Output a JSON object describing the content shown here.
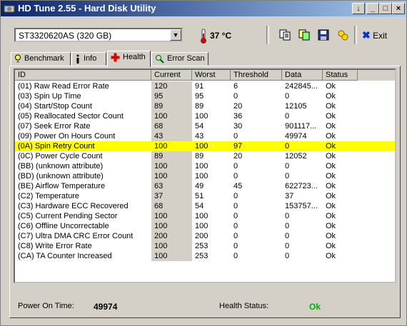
{
  "window": {
    "title": "HD Tune 2.55 - Hard Disk Utility"
  },
  "titlebar_buttons": {
    "down": "↓",
    "minimize": "_",
    "maximize": "□",
    "close": "×"
  },
  "toolbar": {
    "drive": "ST3320620AS (320 GB)",
    "temperature": "37 °C",
    "exit_label": "Exit"
  },
  "tabs": [
    {
      "label": "Benchmark",
      "icon": "lightbulb-icon"
    },
    {
      "label": "Info",
      "icon": "info-icon"
    },
    {
      "label": "Health",
      "icon": "health-cross-icon",
      "active": true
    },
    {
      "label": "Error Scan",
      "icon": "magnifier-icon"
    }
  ],
  "columns": [
    "ID",
    "Current",
    "Worst",
    "Threshold",
    "Data",
    "Status"
  ],
  "rows": [
    {
      "id": "(01) Raw Read Error Rate",
      "current": "120",
      "worst": "91",
      "threshold": "6",
      "data": "242845...",
      "status": "Ok"
    },
    {
      "id": "(03) Spin Up Time",
      "current": "95",
      "worst": "95",
      "threshold": "0",
      "data": "0",
      "status": "Ok"
    },
    {
      "id": "(04) Start/Stop Count",
      "current": "89",
      "worst": "89",
      "threshold": "20",
      "data": "12105",
      "status": "Ok"
    },
    {
      "id": "(05) Reallocated Sector Count",
      "current": "100",
      "worst": "100",
      "threshold": "36",
      "data": "0",
      "status": "Ok"
    },
    {
      "id": "(07) Seek Error Rate",
      "current": "68",
      "worst": "54",
      "threshold": "30",
      "data": "901117...",
      "status": "Ok"
    },
    {
      "id": "(09) Power On Hours Count",
      "current": "43",
      "worst": "43",
      "threshold": "0",
      "data": "49974",
      "status": "Ok"
    },
    {
      "id": "(0A) Spin Retry Count",
      "current": "100",
      "worst": "100",
      "threshold": "97",
      "data": "0",
      "status": "Ok",
      "highlight": true
    },
    {
      "id": "(0C) Power Cycle Count",
      "current": "89",
      "worst": "89",
      "threshold": "20",
      "data": "12052",
      "status": "Ok"
    },
    {
      "id": "(BB) (unknown attribute)",
      "current": "100",
      "worst": "100",
      "threshold": "0",
      "data": "0",
      "status": "Ok"
    },
    {
      "id": "(BD) (unknown attribute)",
      "current": "100",
      "worst": "100",
      "threshold": "0",
      "data": "0",
      "status": "Ok"
    },
    {
      "id": "(BE) Airflow Temperature",
      "current": "63",
      "worst": "49",
      "threshold": "45",
      "data": "622723...",
      "status": "Ok"
    },
    {
      "id": "(C2) Temperature",
      "current": "37",
      "worst": "51",
      "threshold": "0",
      "data": "37",
      "status": "Ok"
    },
    {
      "id": "(C3) Hardware ECC Recovered",
      "current": "68",
      "worst": "54",
      "threshold": "0",
      "data": "153757...",
      "status": "Ok"
    },
    {
      "id": "(C5) Current Pending Sector",
      "current": "100",
      "worst": "100",
      "threshold": "0",
      "data": "0",
      "status": "Ok"
    },
    {
      "id": "(C6) Offline Uncorrectable",
      "current": "100",
      "worst": "100",
      "threshold": "0",
      "data": "0",
      "status": "Ok"
    },
    {
      "id": "(C7) Ultra DMA CRC Error Count",
      "current": "200",
      "worst": "200",
      "threshold": "0",
      "data": "0",
      "status": "Ok"
    },
    {
      "id": "(C8) Write Error Rate",
      "current": "100",
      "worst": "253",
      "threshold": "0",
      "data": "0",
      "status": "Ok"
    },
    {
      "id": "(CA) TA Counter Increased",
      "current": "100",
      "worst": "253",
      "threshold": "0",
      "data": "0",
      "status": "Ok"
    }
  ],
  "footer": {
    "power_on_label": "Power On Time:",
    "power_on_value": "49974",
    "health_label": "Health Status:",
    "health_value": "Ok"
  },
  "colors": {
    "highlight_row": "#ffff00",
    "ok_green": "#00b000",
    "title_start": "#0a246a"
  }
}
